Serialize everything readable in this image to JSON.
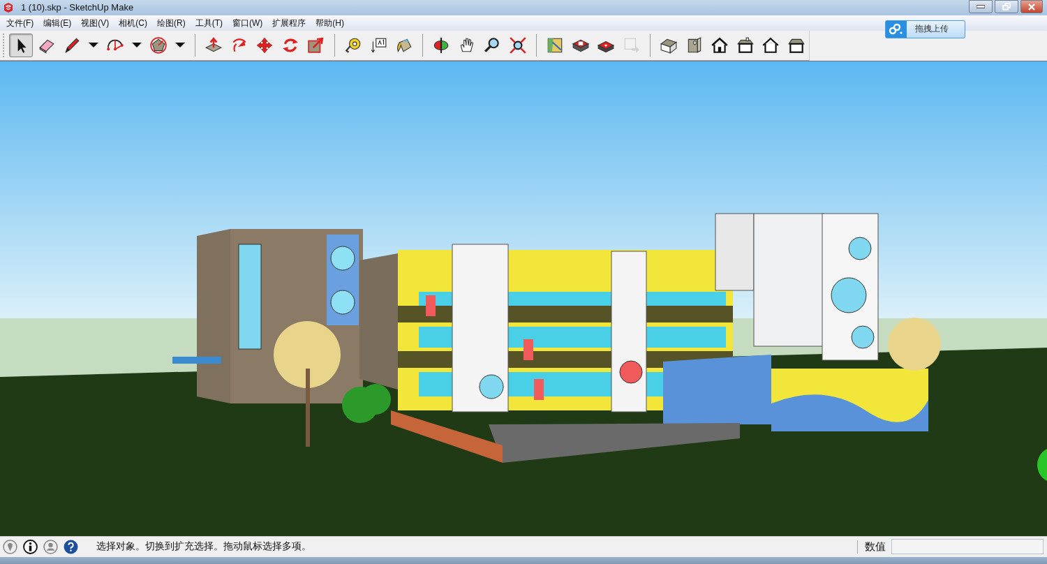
{
  "window": {
    "title": "1 (10).skp - SketchUp Make"
  },
  "menu": [
    {
      "label": "文件(F)"
    },
    {
      "label": "编辑(E)"
    },
    {
      "label": "视图(V)"
    },
    {
      "label": "相机(C)"
    },
    {
      "label": "绘图(R)"
    },
    {
      "label": "工具(T)"
    },
    {
      "label": "窗口(W)"
    },
    {
      "label": "扩展程序"
    },
    {
      "label": "帮助(H)"
    }
  ],
  "upload_button": {
    "label": "拖拽上传"
  },
  "toolbar": {
    "groups": [
      {
        "tools": [
          {
            "kind": "select",
            "selected": true,
            "disabled": false
          },
          {
            "kind": "eraser",
            "selected": false,
            "disabled": false
          },
          {
            "kind": "pencil",
            "selected": false,
            "disabled": false
          },
          {
            "kind": "dropdown",
            "selected": false,
            "disabled": false
          },
          {
            "kind": "arc",
            "selected": false,
            "disabled": false
          },
          {
            "kind": "dropdown",
            "selected": false,
            "disabled": false
          },
          {
            "kind": "polygon",
            "selected": false,
            "disabled": false
          },
          {
            "kind": "dropdown",
            "selected": false,
            "disabled": false
          }
        ]
      },
      {
        "tools": [
          {
            "kind": "pushpull",
            "selected": false,
            "disabled": false
          },
          {
            "kind": "followme",
            "selected": false,
            "disabled": false
          },
          {
            "kind": "move",
            "selected": false,
            "disabled": false
          },
          {
            "kind": "rotate",
            "selected": false,
            "disabled": false
          },
          {
            "kind": "scale",
            "selected": false,
            "disabled": false
          }
        ]
      },
      {
        "tools": [
          {
            "kind": "tape",
            "selected": false,
            "disabled": false
          },
          {
            "kind": "text",
            "selected": false,
            "disabled": false
          },
          {
            "kind": "paint",
            "selected": false,
            "disabled": false
          }
        ]
      },
      {
        "tools": [
          {
            "kind": "orbit",
            "selected": false,
            "disabled": false
          },
          {
            "kind": "pan",
            "selected": false,
            "disabled": false
          },
          {
            "kind": "zoom",
            "selected": false,
            "disabled": false
          },
          {
            "kind": "zoomext",
            "selected": false,
            "disabled": false
          }
        ]
      },
      {
        "tools": [
          {
            "kind": "map",
            "selected": false,
            "disabled": false
          },
          {
            "kind": "warehouse",
            "selected": false,
            "disabled": false
          },
          {
            "kind": "extension",
            "selected": false,
            "disabled": false
          },
          {
            "kind": "share",
            "selected": false,
            "disabled": true
          }
        ]
      },
      {
        "tools": [
          {
            "kind": "iso",
            "selected": false,
            "disabled": false
          },
          {
            "kind": "front",
            "selected": false,
            "disabled": false
          },
          {
            "kind": "housetop",
            "selected": false,
            "disabled": false
          },
          {
            "kind": "houseright",
            "selected": false,
            "disabled": false
          },
          {
            "kind": "houseback",
            "selected": false,
            "disabled": false
          },
          {
            "kind": "houseleft",
            "selected": false,
            "disabled": false
          }
        ]
      }
    ]
  },
  "status_bar": {
    "message": "选择对象。切换到扩充选择。拖动鼠标选择多项。",
    "measurements_label": "数值"
  }
}
